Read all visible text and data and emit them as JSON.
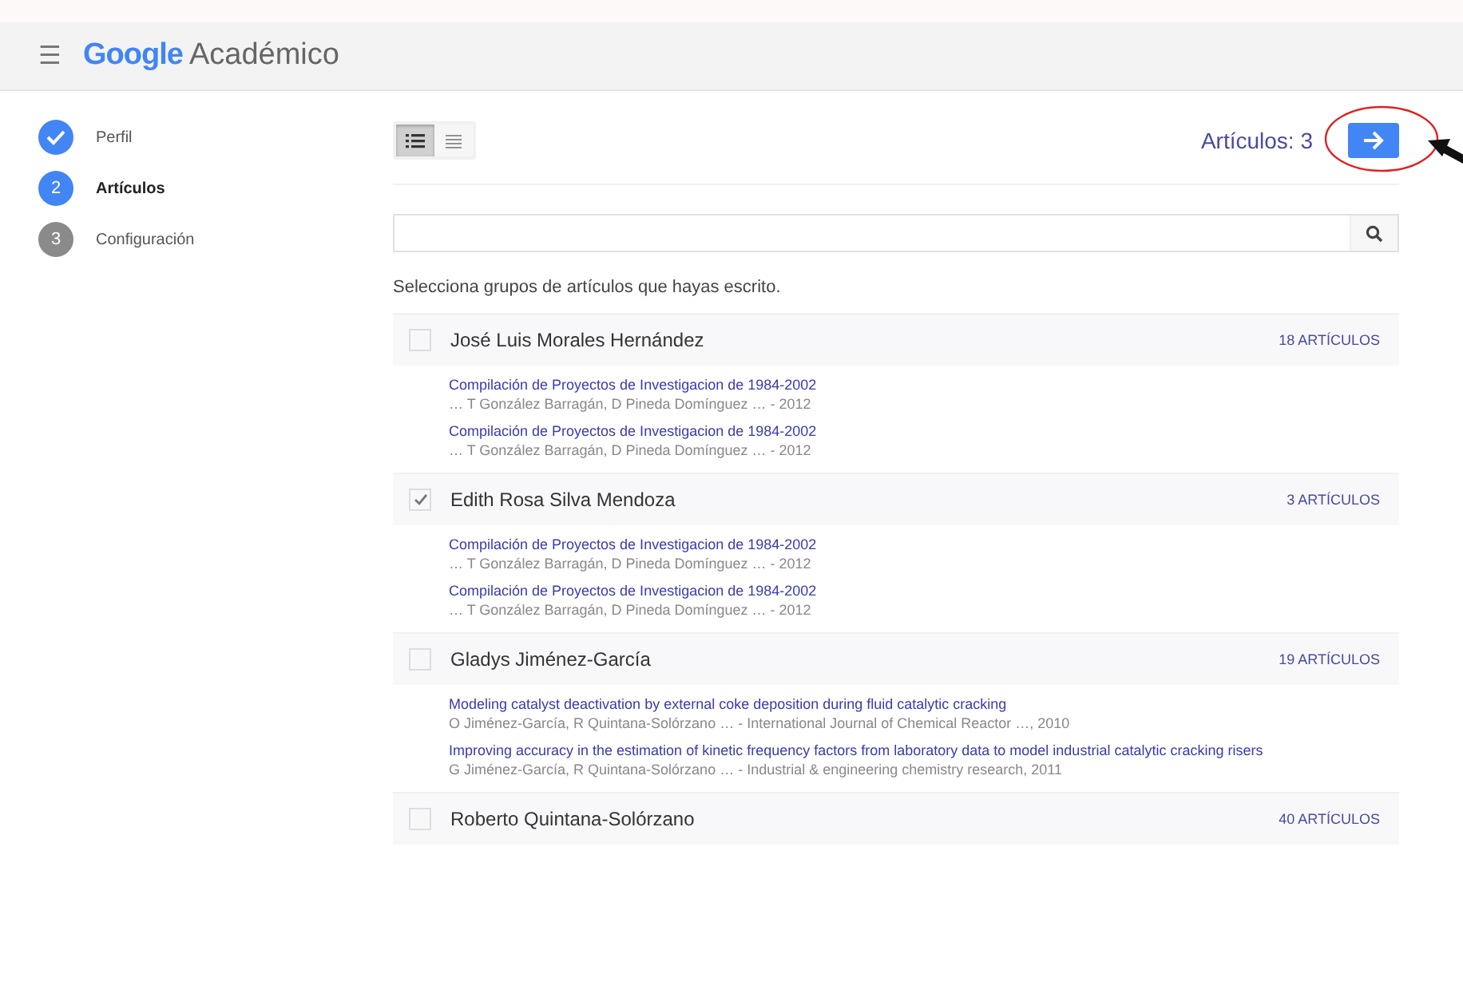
{
  "header": {
    "menu_icon": "☰",
    "logo": "Google",
    "product": "Académico"
  },
  "steps": [
    {
      "label": "Perfil",
      "completed": true,
      "selected": false
    },
    {
      "label": "Artículos",
      "completed": false,
      "selected": true,
      "number": "2"
    },
    {
      "label": "Configuración",
      "completed": false,
      "selected": false,
      "number": "3"
    }
  ],
  "view_toggle": [
    {
      "kind": "detailed",
      "selected": true
    },
    {
      "kind": "compact",
      "selected": false
    }
  ],
  "articles_count": "Artículos: 3",
  "prompt": "Selecciona grupos de artículos que hayas escrito.",
  "groups": [
    {
      "name": "José Luis Morales Hernández",
      "checked": false,
      "count": "18 ARTÍCULOS",
      "articles": [
        {
          "title": "Compilación de Proyectos de Investigacion de 1984-2002",
          "meta": "… T González Barragán, D Pineda Domínguez … - 2012"
        },
        {
          "title": "Compilación de Proyectos de Investigacion de 1984-2002",
          "meta": "… T González Barragán, D Pineda Domínguez … - 2012"
        }
      ]
    },
    {
      "name": "Edith Rosa Silva Mendoza",
      "checked": true,
      "count": "3 ARTÍCULOS",
      "articles": [
        {
          "title": "Compilación de Proyectos de Investigacion de 1984-2002",
          "meta": "… T González Barragán, D Pineda Domínguez … - 2012"
        },
        {
          "title": "Compilación de Proyectos de Investigacion de 1984-2002",
          "meta": "… T González Barragán, D Pineda Domínguez … - 2012"
        }
      ]
    },
    {
      "name": "Gladys Jiménez-García",
      "checked": false,
      "count": "19 ARTÍCULOS",
      "articles": [
        {
          "title": "Modeling catalyst deactivation by external coke deposition during fluid catalytic cracking",
          "meta": "O Jiménez-García, R Quintana-Solórzano … - International Journal of Chemical Reactor …, 2010"
        },
        {
          "title": "Improving accuracy in the estimation of kinetic frequency factors from laboratory data to model industrial catalytic cracking risers",
          "meta": "G Jiménez-García, R Quintana-Solórzano … - Industrial & engineering chemistry research, 2011"
        }
      ]
    },
    {
      "name": "Roberto Quintana-Solórzano",
      "checked": false,
      "count": "40 ARTÍCULOS"
    }
  ]
}
